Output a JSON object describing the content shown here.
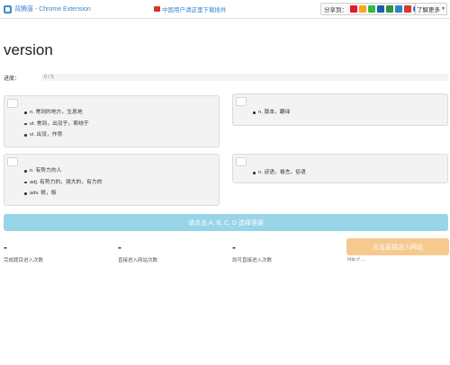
{
  "topbar": {
    "brand": "背腾唐 - Chrome Extension",
    "brand_icon": "app-logo-icon",
    "notice": "中国用户请这里下载插件",
    "notice_icon": "flag-icon",
    "share_label": "分享到：",
    "share_icons": [
      {
        "name": "weibo-icon",
        "color": "#e6162d"
      },
      {
        "name": "qzone-icon",
        "color": "#f5a623"
      },
      {
        "name": "wechat-icon",
        "color": "#2dbb49"
      },
      {
        "name": "renren-icon",
        "color": "#1b5fa8"
      },
      {
        "name": "douban-icon",
        "color": "#2e963d"
      },
      {
        "name": "tencent-weibo-icon",
        "color": "#2a86c8"
      },
      {
        "name": "kaixin-icon",
        "color": "#d33c2e"
      },
      {
        "name": "baidu-icon",
        "color": "#3366cc"
      },
      {
        "name": "more-plus-icon",
        "color": "#4cae4c"
      }
    ],
    "user_menu": "了解更多",
    "user_menu_icon": "caret-down-icon"
  },
  "word": "version",
  "progress": {
    "label": "进度：",
    "text": "0 / 5",
    "fraction": 0,
    "color": "#5bc0de"
  },
  "options": [
    {
      "key": "A",
      "meanings": [
        "n. 常到的地方，生息地",
        "vt. 常到，出没于，萦绕于",
        "vi. 出没，作祟"
      ]
    },
    {
      "key": "B",
      "meanings": [
        "n. 版本，翻译"
      ]
    },
    {
      "key": "C",
      "meanings": [
        "n. 有势力的人",
        "adj. 有势力的，强大的，有力的",
        "adv. 很，极"
      ]
    },
    {
      "key": "D",
      "meanings": [
        "n. 谚语，格言，俗语"
      ]
    }
  ],
  "choose_prompt": "请点击 A, B, C, D 选择答案",
  "stats": [
    {
      "value": "-",
      "label": "完成题目进入次数"
    },
    {
      "value": "-",
      "label": "直接进入网站次数"
    },
    {
      "value": "-",
      "label": "尚可直接进入次数"
    }
  ],
  "enter_button": "点击直接进入网站",
  "url": "http:// ..."
}
